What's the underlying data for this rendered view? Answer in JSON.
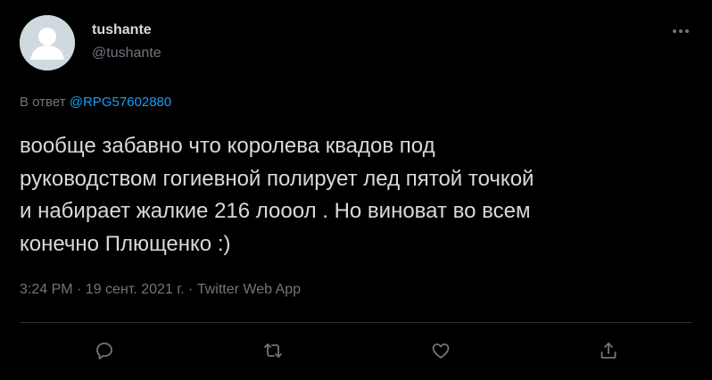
{
  "author": {
    "name": "tushante",
    "handle": "@tushante"
  },
  "reply": {
    "prefix": "В ответ",
    "mention": "@RPG57602880"
  },
  "tweet": {
    "text": "вообще забавно что королева квадов под\nруководством гогиевной полирует лед пятой точкой\nи набирает жалкие 216 лооол . Но виноват во всем\nконечно Плющенко :)"
  },
  "meta": {
    "line": "3:24 PM · 19 сент. 2021 г. · Twitter Web App"
  },
  "actions": {
    "icons": [
      "reply-icon",
      "retweet-icon",
      "like-icon",
      "share-icon"
    ]
  },
  "colors": {
    "background": "#000000",
    "text": "#d9d9d9",
    "secondary": "#6e767d",
    "accent": "#1d9bf0",
    "divider": "#2f3336"
  }
}
